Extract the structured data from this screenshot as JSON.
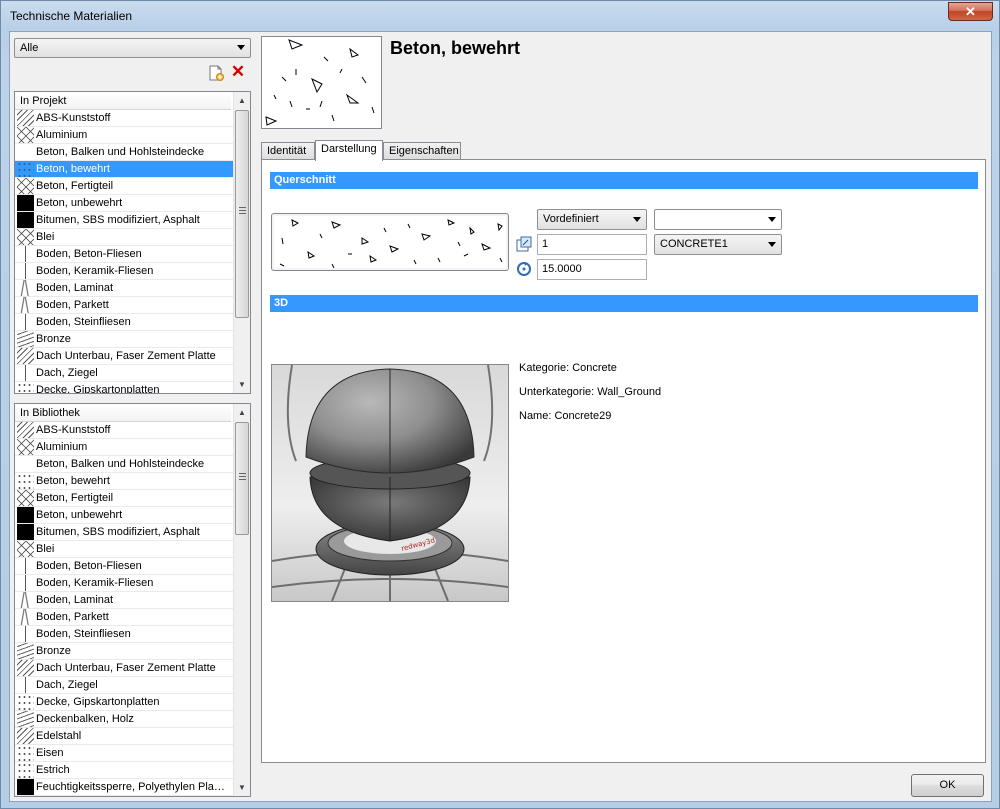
{
  "window": {
    "title": "Technische Materialien",
    "close_label": "✕"
  },
  "filter": {
    "selected": "Alle"
  },
  "project_list": {
    "header": "In Projekt",
    "items": [
      {
        "label": "ABS-Kunststoff",
        "swatch": "hatch"
      },
      {
        "label": "Aluminium",
        "swatch": "diamond"
      },
      {
        "label": "Beton, Balken und Hohlsteindecke",
        "swatch": "none"
      },
      {
        "label": "Beton, bewehrt",
        "swatch": "dots",
        "selected": true
      },
      {
        "label": "Beton, Fertigteil",
        "swatch": "diamond"
      },
      {
        "label": "Beton, unbewehrt",
        "swatch": "black"
      },
      {
        "label": "Bitumen, SBS modifiziert, Asphalt",
        "swatch": "black"
      },
      {
        "label": "Blei",
        "swatch": "diamond"
      },
      {
        "label": "Boden, Beton-Fliesen",
        "swatch": "line"
      },
      {
        "label": "Boden, Keramik-Fliesen",
        "swatch": "line"
      },
      {
        "label": "Boden, Laminat",
        "swatch": "zig"
      },
      {
        "label": "Boden, Parkett",
        "swatch": "zig"
      },
      {
        "label": "Boden, Steinfliesen",
        "swatch": "line"
      },
      {
        "label": "Bronze",
        "swatch": "wave"
      },
      {
        "label": "Dach Unterbau, Faser Zement Platte",
        "swatch": "hatch"
      },
      {
        "label": "Dach, Ziegel",
        "swatch": "line"
      },
      {
        "label": "Decke, Gipskartonplatten",
        "swatch": "dots"
      }
    ]
  },
  "library_list": {
    "header": "In Bibliothek",
    "items": [
      {
        "label": "ABS-Kunststoff",
        "swatch": "hatch"
      },
      {
        "label": "Aluminium",
        "swatch": "diamond"
      },
      {
        "label": "Beton, Balken und Hohlsteindecke",
        "swatch": "none"
      },
      {
        "label": "Beton, bewehrt",
        "swatch": "dots"
      },
      {
        "label": "Beton, Fertigteil",
        "swatch": "diamond"
      },
      {
        "label": "Beton, unbewehrt",
        "swatch": "black"
      },
      {
        "label": "Bitumen, SBS modifiziert, Asphalt",
        "swatch": "black"
      },
      {
        "label": "Blei",
        "swatch": "diamond"
      },
      {
        "label": "Boden, Beton-Fliesen",
        "swatch": "line"
      },
      {
        "label": "Boden, Keramik-Fliesen",
        "swatch": "line"
      },
      {
        "label": "Boden, Laminat",
        "swatch": "zig"
      },
      {
        "label": "Boden, Parkett",
        "swatch": "zig"
      },
      {
        "label": "Boden, Steinfliesen",
        "swatch": "line"
      },
      {
        "label": "Bronze",
        "swatch": "wave"
      },
      {
        "label": "Dach Unterbau, Faser Zement Platte",
        "swatch": "hatch"
      },
      {
        "label": "Dach, Ziegel",
        "swatch": "line"
      },
      {
        "label": "Decke, Gipskartonplatten",
        "swatch": "dots"
      },
      {
        "label": "Deckenbalken, Holz",
        "swatch": "wave"
      },
      {
        "label": "Edelstahl",
        "swatch": "hatch"
      },
      {
        "label": "Eisen",
        "swatch": "dots"
      },
      {
        "label": "Estrich",
        "swatch": "dots"
      },
      {
        "label": "Feuchtigkeitssperre, Polyethylen Pla…",
        "swatch": "black"
      }
    ]
  },
  "material": {
    "name": "Beton, bewehrt"
  },
  "tabs": [
    {
      "label": "Identität",
      "active": false
    },
    {
      "label": "Darstellung",
      "active": true
    },
    {
      "label": "Eigenschaften",
      "active": false
    }
  ],
  "querschnitt": {
    "title": "Querschnitt",
    "pattern_mode": "Vordefiniert",
    "pattern_name": "CONCRETE1",
    "blank_combo": "",
    "scale": "1",
    "angle": "15.0000"
  },
  "section_3d": {
    "title": "3D",
    "category_label": "Kategorie:",
    "category_value": "Concrete",
    "subcategory_label": "Unterkategorie:",
    "subcategory_value": "Wall_Ground",
    "name_label": "Name:",
    "name_value": "Concrete29",
    "render_watermark": "redway3d"
  },
  "footer": {
    "ok_label": "OK"
  },
  "colors": {
    "selection": "#3399ff",
    "section_bar": "#3399ff",
    "close_button": "#c1442a"
  }
}
